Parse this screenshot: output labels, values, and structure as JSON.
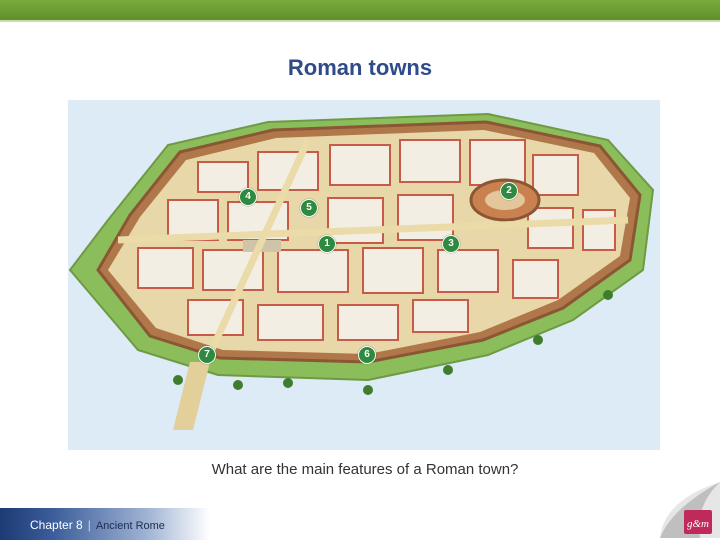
{
  "slide": {
    "title": "Roman towns",
    "question": "What are the main features of a Roman town?"
  },
  "footer": {
    "chapter_label": "Chapter 8",
    "separator": "|",
    "subject": "Ancient Rome",
    "logo_text": "g&m"
  },
  "map": {
    "markers": [
      {
        "label": "2"
      },
      {
        "label": "4"
      },
      {
        "label": "5"
      },
      {
        "label": "1"
      },
      {
        "label": "3"
      },
      {
        "label": "7"
      },
      {
        "label": "6"
      }
    ]
  },
  "colors": {
    "title": "#2f4b8a",
    "top_bar": "#6b9b35",
    "marker": "#2e8a3e",
    "wall": "#b0784a",
    "roof": "#c85a48",
    "street": "#e8d7a8",
    "grass": "#8bbd5a"
  }
}
